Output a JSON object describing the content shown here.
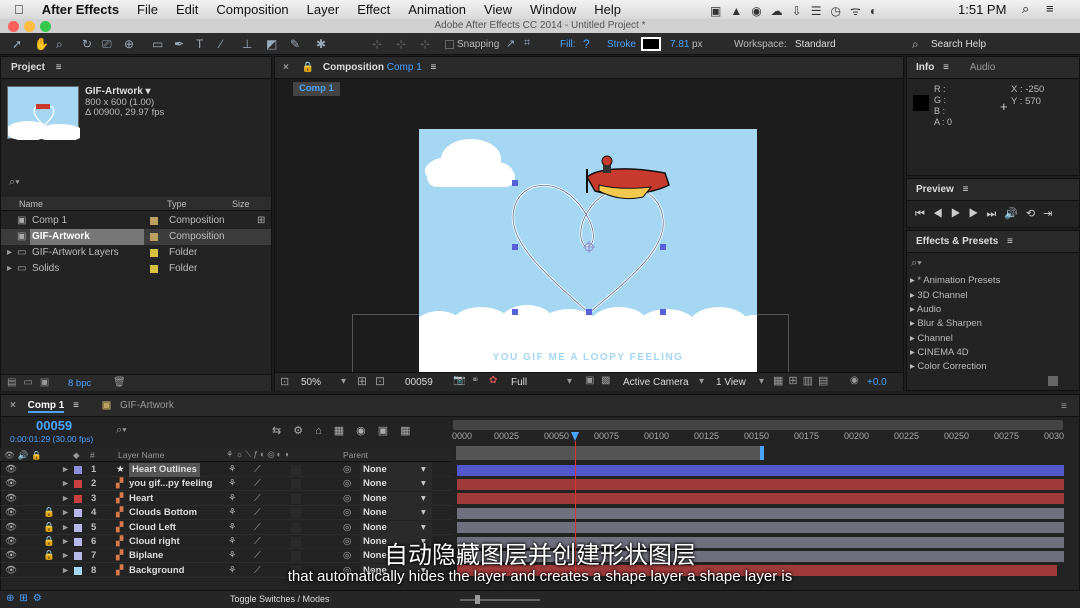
{
  "menubar": {
    "app": "After Effects",
    "items": [
      "File",
      "Edit",
      "Composition",
      "Layer",
      "Effect",
      "Animation",
      "View",
      "Window",
      "Help"
    ],
    "time": "1:51 PM"
  },
  "window_title": "Adobe After Effects CC 2014 - Untitled Project *",
  "toolbar": {
    "snapping": "Snapping",
    "fill": "Fill:",
    "stroke": "Stroke",
    "stroke_width": "7.81",
    "stroke_unit": "px",
    "workspace_label": "Workspace:",
    "workspace": "Standard",
    "search_placeholder": "Search Help"
  },
  "project": {
    "tab": "Project",
    "selected_name": "GIF-Artwork ▾",
    "selected_dims": "800 x 600 (1.00)",
    "selected_dur": "Δ 00900, 29.97 fps",
    "col_name": "Name",
    "col_type": "Type",
    "col_size": "Size",
    "bpc": "8 bpc",
    "items": [
      {
        "name": "Comp 1",
        "type": "Composition",
        "color": "#b9a160"
      },
      {
        "name": "GIF-Artwork",
        "type": "Composition",
        "color": "#b9a160"
      },
      {
        "name": "GIF-Artwork Layers",
        "type": "Folder",
        "color": "#d4c23e"
      },
      {
        "name": "Solids",
        "type": "Folder",
        "color": "#d4c23e"
      }
    ]
  },
  "composition": {
    "tab_prefix": "Composition",
    "tab_name": "Comp 1",
    "subtab": "Comp 1",
    "art_text": "YOU GIF ME A LOOPY FEELING",
    "zoom": "50%",
    "timecode": "00059",
    "resolution": "Full",
    "camera": "Active Camera",
    "views": "1 View",
    "exposure": "+0.0"
  },
  "info": {
    "tab": "Info",
    "tab2": "Audio",
    "r": "R :",
    "g": "G :",
    "b": "B :",
    "a": "A : 0",
    "x": "X : -250",
    "y": "Y : 570"
  },
  "preview": {
    "tab": "Preview"
  },
  "effects": {
    "tab": "Effects & Presets",
    "items": [
      "* Animation Presets",
      "3D Channel",
      "Audio",
      "Blur & Sharpen",
      "Channel",
      "CINEMA 4D",
      "Color Correction"
    ]
  },
  "timeline": {
    "tab1": "Comp 1",
    "tab2": "GIF-Artwork",
    "timecode": "00059",
    "subtime": "0:00:01:29 (30.00 fps)",
    "col_layer": "Layer Name",
    "col_parent": "Parent",
    "toggle": "Toggle Switches / Modes",
    "ticks": [
      "0000",
      "00025",
      "00050",
      "00075",
      "00100",
      "00125",
      "00150",
      "00175",
      "00200",
      "00225",
      "00250",
      "00275",
      "0030"
    ],
    "layers": [
      {
        "num": "1",
        "name": "Heart Outlines",
        "color": "#8f8fd8",
        "parent": "None",
        "bar": "#5257c9"
      },
      {
        "num": "2",
        "name": "you gif...py feeling",
        "color": "#c84040",
        "parent": "None",
        "bar": "#9e3a3a"
      },
      {
        "num": "3",
        "name": "Heart",
        "color": "#c84040",
        "parent": "None",
        "bar": "#9e3a3a"
      },
      {
        "num": "4",
        "name": "Clouds Bottom",
        "color": "#b8b8e8",
        "parent": "None",
        "bar": "#6f6f7e"
      },
      {
        "num": "5",
        "name": "Cloud Left",
        "color": "#b8b8e8",
        "parent": "None",
        "bar": "#6f6f7e"
      },
      {
        "num": "6",
        "name": "Cloud right",
        "color": "#b8b8e8",
        "parent": "None",
        "bar": "#6f6f7e"
      },
      {
        "num": "7",
        "name": "Biplane",
        "color": "#b8b8e8",
        "parent": "None",
        "bar": "#6f6f7e"
      },
      {
        "num": "8",
        "name": "Background",
        "color": "#a6d7f2",
        "parent": "None",
        "bar": "#9e3a3a"
      }
    ]
  },
  "subtitles": {
    "zh": "自动隐藏图层并创建形状图层",
    "en": "that automatically hides the layer and creates a shape layer a shape layer is"
  }
}
